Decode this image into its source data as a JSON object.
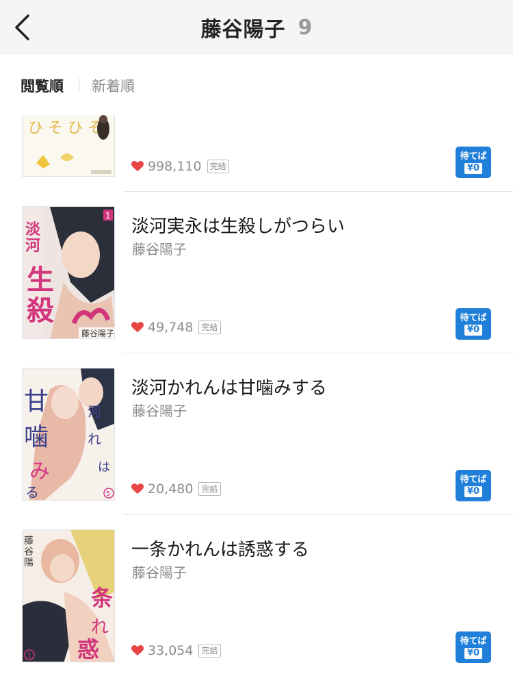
{
  "header": {
    "title": "藤谷陽子",
    "count": "9"
  },
  "sort": {
    "options": [
      "閲覧順",
      "新着順"
    ]
  },
  "books": [
    {
      "title": "",
      "author": "",
      "likes": "998,110",
      "status": "完結",
      "wait_top": "待てば",
      "wait_bottom": "¥0"
    },
    {
      "title": "淡河実永は生殺しがつらい",
      "author": "藤谷陽子",
      "likes": "49,748",
      "status": "完結",
      "wait_top": "待てば",
      "wait_bottom": "¥0"
    },
    {
      "title": "淡河かれんは甘噛みする",
      "author": "藤谷陽子",
      "likes": "20,480",
      "status": "完結",
      "wait_top": "待てば",
      "wait_bottom": "¥0"
    },
    {
      "title": "一条かれんは誘惑する",
      "author": "藤谷陽子",
      "likes": "33,054",
      "status": "完結",
      "wait_top": "待てば",
      "wait_bottom": "¥0"
    }
  ],
  "colors": {
    "accent_blue": "#1f7fd9",
    "heart_red": "#e84545",
    "header_bg": "#f5f5f5"
  },
  "icons": [
    "back-chevron-icon",
    "heart-icon"
  ]
}
